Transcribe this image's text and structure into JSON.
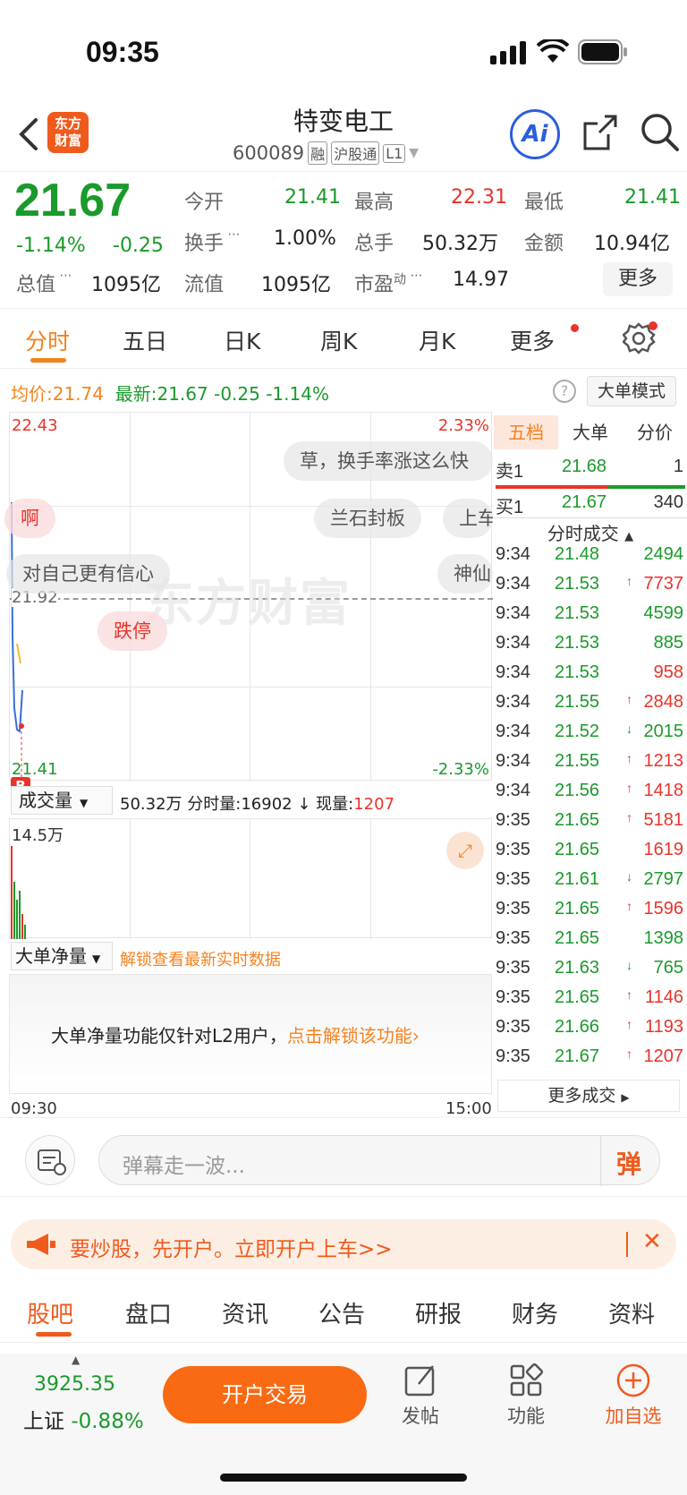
{
  "status": {
    "time": "09:35"
  },
  "header": {
    "logo_text": "东方财富",
    "stock_name": "特变电工",
    "stock_code": "600089",
    "tags": [
      "融",
      "沪股通",
      "L1"
    ],
    "ai_label": "Ai"
  },
  "quote": {
    "price": "21.67",
    "change_pct": "-1.14%",
    "change": "-0.25",
    "open_label": "今开",
    "open": "21.41",
    "high_label": "最高",
    "high": "22.31",
    "low_label": "最低",
    "low": "21.41",
    "turnover_label": "换手",
    "turnover": "1.00%",
    "volume_label": "总手",
    "volume": "50.32万",
    "amount_label": "金额",
    "amount": "10.94亿",
    "mcap_label": "总值",
    "mcap": "1095亿",
    "float_label": "流值",
    "float": "1095亿",
    "pe_label": "市盈",
    "pe_sup": "动",
    "pe": "14.97",
    "more_label": "更多"
  },
  "chart_tabs": [
    "分时",
    "五日",
    "日K",
    "周K",
    "月K",
    "更多"
  ],
  "info_bar": {
    "avg_label": "均价:",
    "avg": "21.74",
    "latest_label": "最新:",
    "latest": "21.67",
    "chg": "-0.25",
    "pct": "-1.14%",
    "big_order_mode": "大单模式"
  },
  "chart": {
    "y_high": "22.43",
    "y_low": "21.41",
    "y_mid": "21.92",
    "pct_high": "2.33%",
    "pct_low": "-2.33%",
    "watermark": "东方财富",
    "danmu": [
      "草，换手率涨这么快",
      "兰石封板",
      "上车",
      "啊",
      "对自己更有信心",
      "神仙",
      "跌停"
    ]
  },
  "volume_bar": {
    "selector": "成交量",
    "total": "50.32万",
    "minute_label": "分时量:",
    "minute_value": "16902",
    "now_label": "现量:",
    "now_value": "1207",
    "max_label": "14.5万"
  },
  "net_bar": {
    "selector": "大单净量",
    "unlock": "解锁查看最新实时数据",
    "message": "大单净量功能仅针对L2用户，",
    "message_link": "点击解锁该功能"
  },
  "time_axis": {
    "start": "09:30",
    "end": "15:00"
  },
  "order_book": {
    "tabs": [
      "五档",
      "大单",
      "分价"
    ],
    "sell1": {
      "label": "卖1",
      "price": "21.68",
      "vol": "1"
    },
    "buy1": {
      "label": "买1",
      "price": "21.67",
      "vol": "340"
    },
    "ticks_title": "分时成交",
    "ticks": [
      {
        "t": "9:34",
        "p": "21.48",
        "v": "2494",
        "d": "",
        "c": "green"
      },
      {
        "t": "9:34",
        "p": "21.53",
        "v": "7737",
        "d": "↑",
        "c": "red"
      },
      {
        "t": "9:34",
        "p": "21.53",
        "v": "4599",
        "d": "",
        "c": "green"
      },
      {
        "t": "9:34",
        "p": "21.53",
        "v": "885",
        "d": "",
        "c": "green"
      },
      {
        "t": "9:34",
        "p": "21.53",
        "v": "958",
        "d": "",
        "c": "red"
      },
      {
        "t": "9:34",
        "p": "21.55",
        "v": "2848",
        "d": "↑",
        "c": "red"
      },
      {
        "t": "9:34",
        "p": "21.52",
        "v": "2015",
        "d": "↓",
        "c": "green"
      },
      {
        "t": "9:34",
        "p": "21.55",
        "v": "1213",
        "d": "↑",
        "c": "red"
      },
      {
        "t": "9:34",
        "p": "21.56",
        "v": "1418",
        "d": "↑",
        "c": "red"
      },
      {
        "t": "9:35",
        "p": "21.65",
        "v": "5181",
        "d": "↑",
        "c": "red"
      },
      {
        "t": "9:35",
        "p": "21.65",
        "v": "1619",
        "d": "",
        "c": "red"
      },
      {
        "t": "9:35",
        "p": "21.61",
        "v": "2797",
        "d": "↓",
        "c": "green"
      },
      {
        "t": "9:35",
        "p": "21.65",
        "v": "1596",
        "d": "↑",
        "c": "red"
      },
      {
        "t": "9:35",
        "p": "21.65",
        "v": "1398",
        "d": "",
        "c": "green"
      },
      {
        "t": "9:35",
        "p": "21.63",
        "v": "765",
        "d": "↓",
        "c": "green"
      },
      {
        "t": "9:35",
        "p": "21.65",
        "v": "1146",
        "d": "↑",
        "c": "red"
      },
      {
        "t": "9:35",
        "p": "21.66",
        "v": "1193",
        "d": "↑",
        "c": "red"
      },
      {
        "t": "9:35",
        "p": "21.67",
        "v": "1207",
        "d": "↑",
        "c": "red"
      }
    ],
    "more_ticks": "更多成交"
  },
  "comment": {
    "placeholder": "弹幕走一波...",
    "send_label": "弹"
  },
  "promo": {
    "text": "要炒股，先开户。立即开户上车>>"
  },
  "bottom_tabs": [
    "股吧",
    "盘口",
    "资讯",
    "公告",
    "研报",
    "财务",
    "资料"
  ],
  "footer": {
    "index_value": "3925.35",
    "index_name": "上证",
    "index_pct": "-0.88%",
    "trade_button": "开户交易",
    "post_label": "发帖",
    "func_label": "功能",
    "watch_label": "加自选"
  },
  "colors": {
    "up": "#e8332b",
    "down": "#1a9a2a",
    "accent": "#f5821f",
    "ai": "#2a5fdc"
  }
}
